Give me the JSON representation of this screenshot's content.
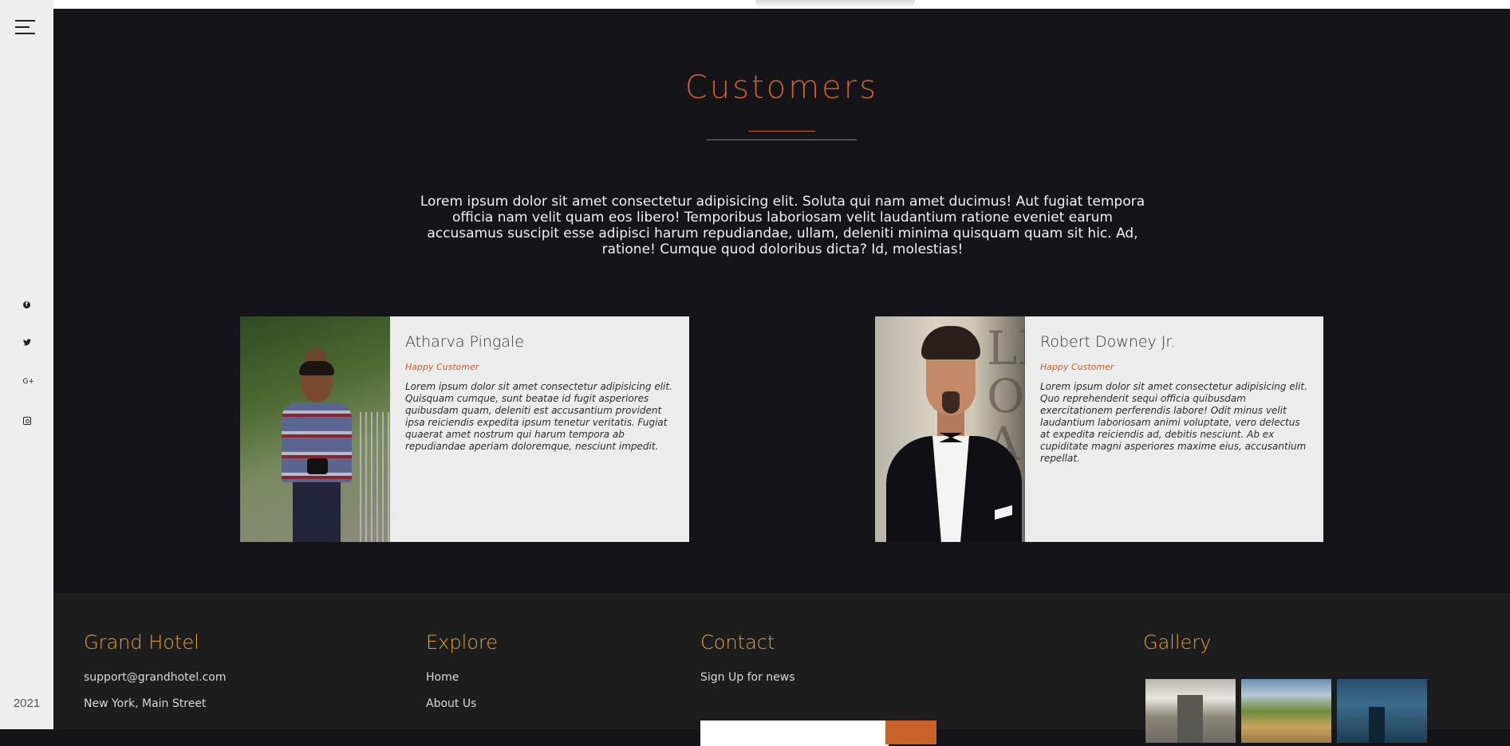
{
  "sidebar": {
    "menu_icon": "hamburger-menu-icon",
    "social_icons": [
      "facebook-icon",
      "twitter-icon",
      "google-plus-icon",
      "instagram-icon"
    ],
    "year": "2021"
  },
  "customers": {
    "title": "Customers",
    "intro": "Lorem ipsum dolor sit amet consectetur adipisicing elit. Soluta qui nam amet ducimus! Aut fugiat tempora officia nam velit quam eos libero! Temporibus laboriosam velit laudantium ratione eveniet earum accusamus suscipit esse adipisci harum repudiandae, ullam, deleniti minima quisquam quam sit hic. Ad, ratione! Cumque quod doloribus dicta? Id, molestias!",
    "cards": [
      {
        "name": "Atharva Pingale",
        "role": "Happy Customer",
        "quote": "Lorem ipsum dolor sit amet consectetur adipisicing elit. Quisquam cumque, sunt beatae id fugit asperiores quibusdam quam, deleniti est accusantium provident ipsa reiciendis expedita ipsum tenetur veritatis. Fugiat quaerat amet nostrum qui harum tempora ab repudiandae aperiam doloremque, nesciunt impedit."
      },
      {
        "name": "Robert Downey Jr.",
        "role": "Happy Customer",
        "quote": "Lorem ipsum dolor sit amet consectetur adipisicing elit. Quo reprehenderit sequi officia quibusdam exercitationem perferendis labore! Odit minus velit laudantium laboriosam animi voluptate, vero delectus at expedita reiciendis ad, debitis nesciunt. Ab ex cupiditate magni asperiores maxime eius, accusantium repellat."
      }
    ]
  },
  "footer": {
    "brand": {
      "title": "Grand Hotel",
      "email": "support@grandhotel.com",
      "address": "New York, Main Street"
    },
    "explore": {
      "title": "Explore",
      "links": [
        "Home",
        "About Us"
      ]
    },
    "contact": {
      "title": "Contact",
      "signup_text": "Sign Up for news"
    },
    "gallery": {
      "title": "Gallery"
    }
  },
  "colors": {
    "accent": "#c8612a",
    "footer_heading": "#e0a03a",
    "background": "#141419"
  }
}
